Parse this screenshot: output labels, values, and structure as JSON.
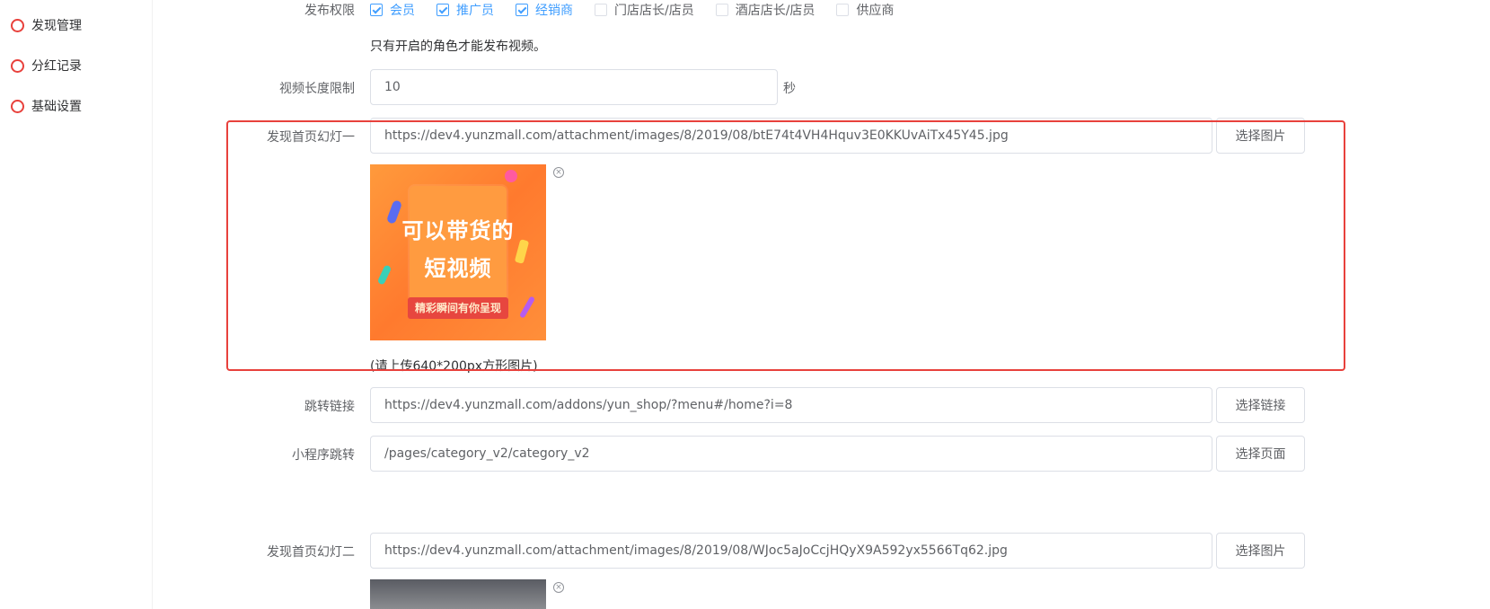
{
  "sidebar": {
    "items": [
      {
        "label": "发现管理"
      },
      {
        "label": "分红记录"
      },
      {
        "label": "基础设置"
      }
    ]
  },
  "form": {
    "publish": {
      "label": "发布权限",
      "options": [
        {
          "label": "会员",
          "checked": true
        },
        {
          "label": "推广员",
          "checked": true
        },
        {
          "label": "经销商",
          "checked": true
        },
        {
          "label": "门店店长/店员",
          "checked": false
        },
        {
          "label": "酒店店长/店员",
          "checked": false
        },
        {
          "label": "供应商",
          "checked": false
        }
      ],
      "hint": "只有开启的角色才能发布视频。"
    },
    "video_limit": {
      "label": "视频长度限制",
      "value": "10",
      "unit": "秒"
    },
    "slide1": {
      "label": "发现首页幻灯一",
      "value": "https://dev4.yunzmall.com/attachment/images/8/2019/08/btE74t4VH4Hquv3E0KKUvAiTx45Y45.jpg",
      "button": "选择图片",
      "image_line1": "可以带货的",
      "image_line2": "短视频",
      "image_ribbon": "精彩瞬间有你呈现",
      "hint": "(请上传640*200px方形图片)"
    },
    "jump_link": {
      "label": "跳转链接",
      "value": "https://dev4.yunzmall.com/addons/yun_shop/?menu#/home?i=8",
      "button": "选择链接"
    },
    "mini_jump": {
      "label": "小程序跳转",
      "value": "/pages/category_v2/category_v2",
      "button": "选择页面"
    },
    "slide2": {
      "label": "发现首页幻灯二",
      "value": "https://dev4.yunzmall.com/attachment/images/8/2019/08/WJoc5aJoCcjHQyX9A592yx5566Tq62.jpg",
      "button": "选择图片"
    }
  },
  "colors": {
    "accent": "#409eff",
    "highlight": "#e8413c",
    "sidebar_ring": "#e8413c"
  }
}
